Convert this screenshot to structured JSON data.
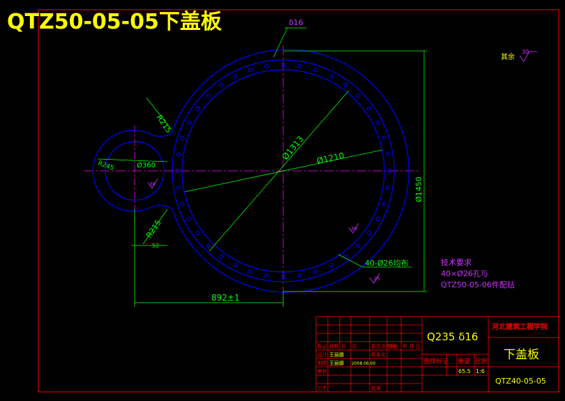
{
  "drawing": {
    "title": "QTZ50-05-05下盖板",
    "thickness_label": "δ16",
    "colors": {
      "background": "#000000",
      "frame": "#ff0000",
      "part": "#0000ff",
      "dimension": "#00ff00",
      "center": "#ff00ff",
      "text_note": "#cc33ff",
      "title": "#ffff00",
      "white_line": "#ffffff"
    }
  },
  "dimensions": {
    "r215_top": "R215",
    "r215_bottom": "R215",
    "r245": "R245",
    "d360": "Ø360",
    "d1313": "Ø1313",
    "d1210": "Ø1210",
    "d1450": "Ø1450",
    "len892": "892±1",
    "holes": "40-Ø26均布",
    "r52": "52",
    "rough_small_1": "30",
    "rough_small_2": "30",
    "rough_small_3": "25"
  },
  "roughness_note": {
    "label": "其余",
    "value": "30"
  },
  "tech_requirements": {
    "heading": "技术要求",
    "line1": "40×Ø26孔与",
    "line2": "QTZ50-05-06件配钻"
  },
  "title_block": {
    "material": "Q235 δ16",
    "school": "河北建筑工程学院",
    "part_name": "下盖板",
    "drawing_no": "QTZ40-05-05",
    "stage_label": "图样标记",
    "weight_label": "重量",
    "scale_label": "比例",
    "weight": "65.5",
    "scale": "1:6",
    "rev_cols": [
      "标记",
      "处数",
      "分",
      "区",
      "更改文件号",
      "签名",
      "年 月 日"
    ],
    "design_label": "设计",
    "designer": "王丽娜",
    "std_label": "标准化",
    "draw_label": "制图",
    "drawer": "王丽娜",
    "draw_date": "2008.06.00",
    "review_label": "审核",
    "process_label": "工艺",
    "approve_label": "批准"
  }
}
